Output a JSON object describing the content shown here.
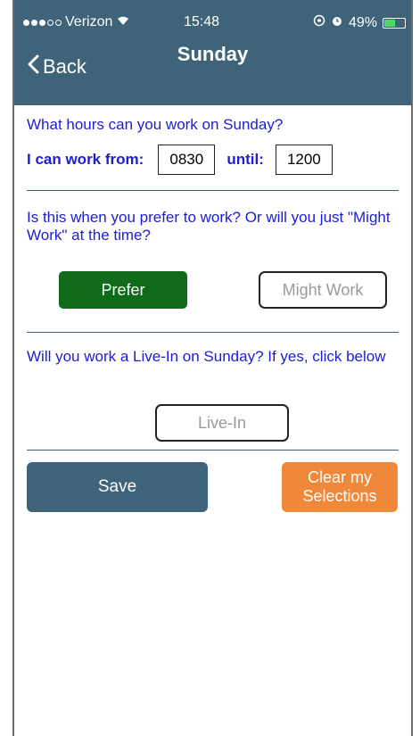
{
  "status_bar": {
    "carrier": "Verizon",
    "time": "15:48",
    "battery": "49%"
  },
  "nav": {
    "back_label": "Back",
    "title": "Sunday"
  },
  "hours": {
    "question": "What hours can you work on Sunday?",
    "from_label": "I can work from:",
    "from_value": "0830",
    "until_label": "until:",
    "until_value": "1200"
  },
  "preference": {
    "question": "Is this when you prefer to work? Or will you just \"Might Work\" at the time?",
    "prefer_label": "Prefer",
    "might_work_label": "Might Work"
  },
  "live_in": {
    "question": "Will you work a Live-In on Sunday? If yes, click below",
    "button_label": "Live-In"
  },
  "actions": {
    "save_label": "Save",
    "clear_line1": "Clear my",
    "clear_line2": "Selections"
  },
  "colors": {
    "nav_bg": "#3f6479",
    "question_text": "#1d1dd6",
    "prefer_green": "#0f6b1a",
    "clear_orange": "#f0883a"
  }
}
